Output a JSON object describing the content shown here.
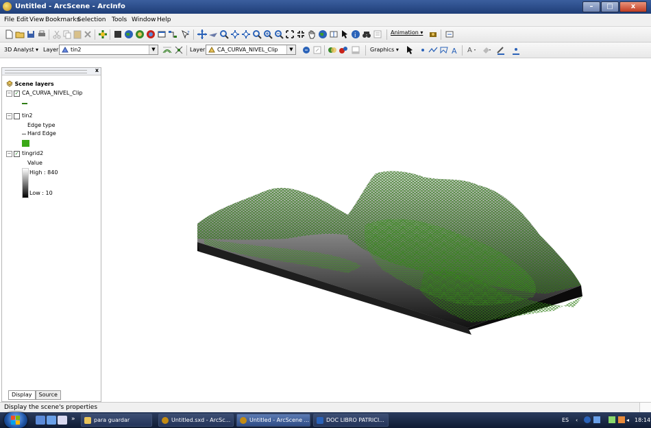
{
  "window": {
    "title": "Untitled - ArcScene - ArcInfo",
    "controls": [
      "minimize",
      "maximize",
      "close"
    ]
  },
  "menu": [
    "File",
    "Edit",
    "View",
    "Bookmarks",
    "Selection",
    "Tools",
    "Window",
    "Help"
  ],
  "toolbar1": {
    "animation_label": "Animation",
    "icons": [
      "new-icon",
      "open-icon",
      "save-icon",
      "print-icon",
      "cut-icon",
      "copy-icon",
      "paste-icon",
      "delete-icon",
      "add-data-icon",
      "scene-properties-icon",
      "arctoolbox-icon",
      "command-line-icon",
      "navigate-icon",
      "fly-icon",
      "target-icon",
      "zoom-to-target-icon",
      "zoom-in-icon",
      "zoom-out-icon",
      "pan-icon",
      "full-extent-icon",
      "select-features-icon",
      "identify-icon",
      "find-icon",
      "measure-icon"
    ]
  },
  "toolbar2": {
    "analyst_label": "3D Analyst",
    "layer1_label": "Layer:",
    "layer1_value": "tin2",
    "layer2_label": "Layer:",
    "layer2_value": "CA_CURVA_NIVEL_Clip",
    "graphics_label": "Graphics"
  },
  "toc": {
    "header": "Scene layers",
    "layers": [
      {
        "name": "CA_CURVA_NIVEL_Clip",
        "checked": true,
        "expanded": true
      },
      {
        "name": "tin2",
        "checked": false,
        "expanded": true,
        "legend_title": "Edge type",
        "legend_item": "Hard Edge"
      },
      {
        "name": "tingrid2",
        "checked": true,
        "expanded": true,
        "legend_title": "Value",
        "high": "High : 840",
        "low": "Low : 10"
      }
    ],
    "tabs": [
      "Display",
      "Source"
    ]
  },
  "status": "Display the scene's properties",
  "taskbar": {
    "tasks": [
      {
        "label": "para guardar"
      },
      {
        "label": "Untitled.sxd - ArcSc..."
      },
      {
        "label": "Untitled - ArcScene ..."
      },
      {
        "label": "DOC LIBRO PATRICI..."
      }
    ],
    "overflow": "»",
    "lang": "ES",
    "clock": "18:14"
  },
  "colors": {
    "title_bar": "#1f3e78",
    "contour_green": "#2f7d14",
    "terrain_dark": "#121212",
    "terrain_light": "#d9d9d9",
    "taskbar": "#0f1b33"
  }
}
